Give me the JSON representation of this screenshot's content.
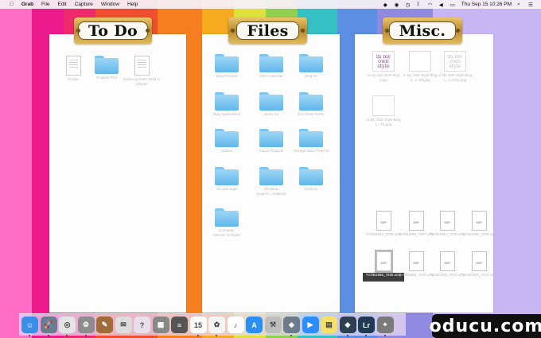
{
  "menubar": {
    "app_name": "Grab",
    "menus": [
      "File",
      "Edit",
      "Capture",
      "Window",
      "Help"
    ],
    "clock": "Thu Sep 15  10:26 PM"
  },
  "wallpaper": {
    "stripes": [
      "#ff6ec4",
      "#ee1b8f",
      "#ee2a6d",
      "#ee4e2b",
      "#f57f1f",
      "#f6aa1f",
      "#dde23a",
      "#8fd14f",
      "#35c0c4",
      "#5c8fe3",
      "#8f8ae0",
      "#c8b6f4"
    ]
  },
  "panels": {
    "todo": {
      "title": "To Do",
      "items": [
        {
          "kind": "doc",
          "label": "Scripts"
        },
        {
          "kind": "folder",
          "label": "Projects PSA"
        },
        {
          "kind": "doc",
          "label": "Follow up letter 2016 to Adophe"
        }
      ]
    },
    "files": {
      "title": "Files",
      "items": [
        {
          "kind": "folder",
          "label": "Blog Pictures"
        },
        {
          "kind": "folder",
          "label": "2017 Calendar"
        },
        {
          "kind": "folder",
          "label": "Blog Art"
        },
        {
          "kind": "folder",
          "label": "Blog Applications"
        },
        {
          "kind": "folder",
          "label": "Istock Art"
        },
        {
          "kind": "folder",
          "label": "Ent Client Fonts"
        },
        {
          "kind": "folder",
          "label": "Videos"
        },
        {
          "kind": "folder",
          "label": "Future Projects"
        },
        {
          "kind": "folder",
          "label": "Storage Save Projects"
        },
        {
          "kind": "folder",
          "label": "You Dot Style"
        },
        {
          "kind": "folder",
          "label": "Desktop Organiz...ctobjects"
        },
        {
          "kind": "folder",
          "label": "Invoices"
        },
        {
          "kind": "folder",
          "label": "Computer Instruct...Includes"
        }
      ]
    },
    "misc": {
      "title": "Misc.",
      "images": [
        {
          "kind": "logo",
          "text": "in my own style",
          "label": "in my own style Blog Logo"
        },
        {
          "kind": "blank",
          "label": "in My Own Style Blog L...o 400.jpg"
        },
        {
          "kind": "logo-alt",
          "text": "in my own style",
          "label": "in My Own Style Blog L...o Grey.png"
        },
        {
          "kind": "blank",
          "label": "in My Own Style Blog L...Tb.png"
        }
      ],
      "xmp_files": [
        {
          "label": "TVOB1662_7636.xmp",
          "selected": false
        },
        {
          "label": "TVOB1662_7637.xmp",
          "selected": false
        },
        {
          "label": "TVOB1664_7638.xmp",
          "selected": false
        },
        {
          "label": "TVOB1665_7639.xmp",
          "selected": false
        },
        {
          "label": "TVOB1665_7636.xmp",
          "selected": true
        },
        {
          "label": "TVOB1666_7640.xmp",
          "selected": false
        },
        {
          "label": "TVOB1668_7641.xmp",
          "selected": false
        },
        {
          "label": "TVOB1669_7642.xmp",
          "selected": false
        }
      ]
    }
  },
  "dock": {
    "apps": [
      {
        "name": "Finder",
        "color": "#3a8eea",
        "glyph": "☺"
      },
      {
        "name": "Launchpad",
        "color": "#6b7c91",
        "glyph": "🚀"
      },
      {
        "name": "Chrome",
        "color": "#e4e4e4",
        "glyph": "◎"
      },
      {
        "name": "System Preferences",
        "color": "#8d8d8d",
        "glyph": "⚙"
      },
      {
        "name": "Notes",
        "color": "#a06c3a",
        "glyph": "✎"
      },
      {
        "name": "Mail",
        "color": "#dddddd",
        "glyph": "✉"
      },
      {
        "name": "Help",
        "color": "#e9dfea",
        "glyph": "?"
      },
      {
        "name": "Preview",
        "color": "#888888",
        "glyph": "▦"
      },
      {
        "name": "TextEdit",
        "color": "#555555",
        "glyph": "≡"
      },
      {
        "name": "Calendar",
        "color": "#ffffff",
        "glyph": "15"
      },
      {
        "name": "Photos",
        "color": "#f5f5f5",
        "glyph": "✿"
      },
      {
        "name": "iTunes",
        "color": "#ffffff",
        "glyph": "♪"
      },
      {
        "name": "App Store",
        "color": "#2a8ef5",
        "glyph": "A"
      },
      {
        "name": "Automator",
        "color": "#bdbdbd",
        "glyph": "⚒"
      },
      {
        "name": "Screenshot",
        "color": "#6c7a8a",
        "glyph": "◈"
      },
      {
        "name": "Zoom",
        "color": "#2d8cff",
        "glyph": "▶"
      },
      {
        "name": "Stickies",
        "color": "#f4e06a",
        "glyph": "▤"
      },
      {
        "name": "Capture One",
        "color": "#2f3f52",
        "glyph": "◈"
      },
      {
        "name": "Lightroom",
        "color": "#1f3a52",
        "glyph": "Lr"
      },
      {
        "name": "Grab",
        "color": "#7a7a7a",
        "glyph": "⌖"
      }
    ]
  },
  "watermark": "oducu.com"
}
